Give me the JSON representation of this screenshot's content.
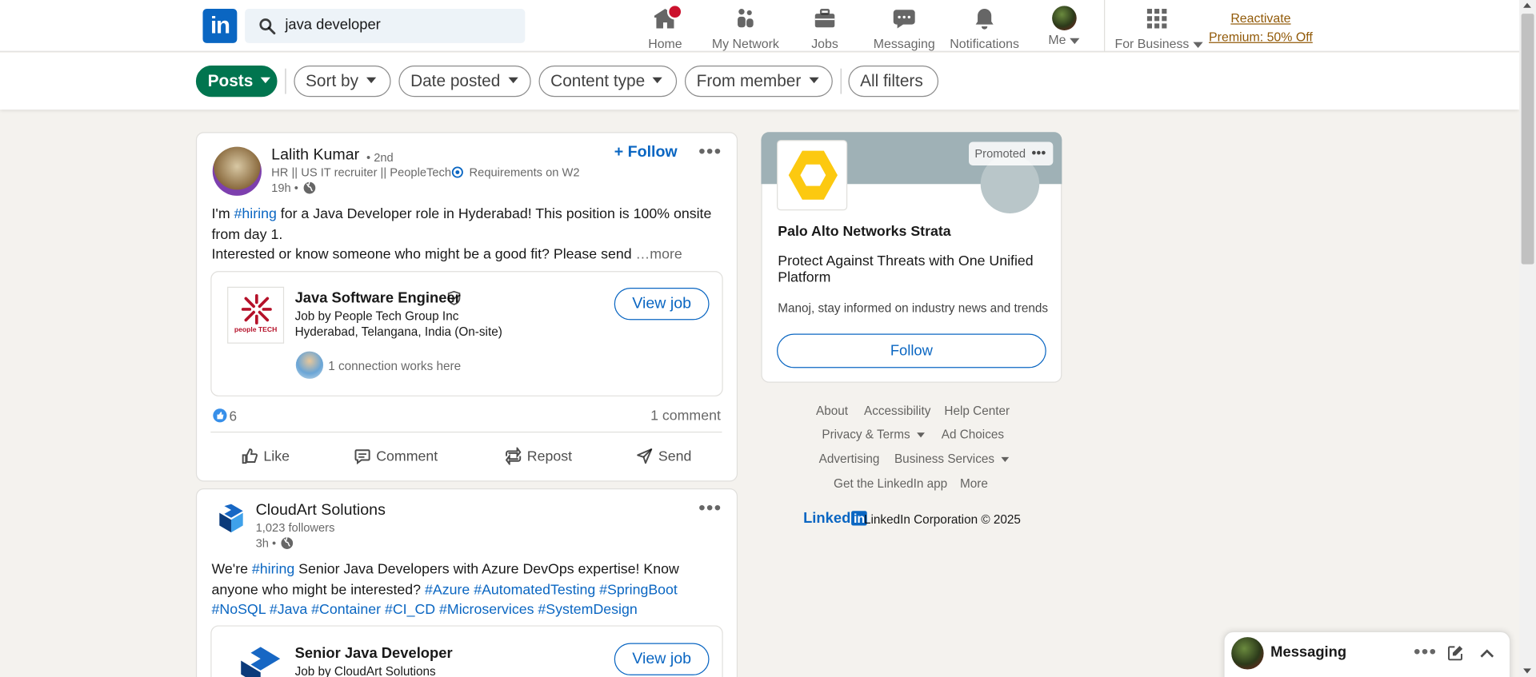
{
  "header": {
    "logo": "in",
    "search_value": "java developer",
    "nav": [
      {
        "label": "Home",
        "icon": "home-icon"
      },
      {
        "label": "My Network",
        "icon": "people-icon"
      },
      {
        "label": "Jobs",
        "icon": "briefcase-icon"
      },
      {
        "label": "Messaging",
        "icon": "chat-icon"
      },
      {
        "label": "Notifications",
        "icon": "bell-icon"
      },
      {
        "label": "Me",
        "icon": "avatar"
      },
      {
        "label": "For Business",
        "icon": "grid-icon"
      }
    ],
    "premium": "Reactivate Premium: 50% Off"
  },
  "filters": {
    "posts": "Posts",
    "sort_by": "Sort by",
    "date_posted": "Date posted",
    "content_type": "Content type",
    "from_member": "From member",
    "all_filters": "All filters"
  },
  "post1": {
    "author": "Lalith Kumar",
    "degree": "• 2nd",
    "headline": "HR || US IT recruiter || PeopleTech",
    "headline_extra": "Requirements on W2",
    "time": "19h •",
    "follow": "+ Follow",
    "text_pre": "I'm ",
    "hashtag": "#hiring",
    "text_post": " for a Java Developer role in Hyderabad! This position is 100% onsite from day 1.",
    "text_line3": "Interested or know someone who might be a good fit? Please send",
    "more": "…more",
    "job": {
      "title": "Java Software Engineer",
      "company": "Job by People Tech Group Inc",
      "location": "Hyderabad, Telangana, India (On-site)",
      "connection": "1 connection works here",
      "logo_text": "people TECH",
      "view_job": "View job"
    },
    "reactions": "6",
    "comments": "1 comment",
    "actions": {
      "like": "Like",
      "comment": "Comment",
      "repost": "Repost",
      "send": "Send"
    }
  },
  "post2": {
    "author": "CloudArt Solutions",
    "followers": "1,023 followers",
    "time": "3h •",
    "text_pre": "We're ",
    "hashtag": "#hiring",
    "text_post": " Senior Java Developers with Azure DevOps expertise! Know anyone who might be interested?",
    "tags": "#Azure #AutomatedTesting #SpringBoot #NoSQL #Java #Container #CI_CD #Microservices #SystemDesign",
    "job": {
      "title": "Senior Java Developer",
      "company": "Job by CloudArt Solutions",
      "view_job": "View job"
    }
  },
  "ad": {
    "promoted": "Promoted",
    "company": "Palo Alto Networks Strata",
    "headline": "Protect Against Threats with One Unified Platform",
    "subtext": "Manoj, stay informed on industry news and trends",
    "follow": "Follow"
  },
  "footer": {
    "links_row1": [
      "About",
      "Accessibility",
      "Help Center"
    ],
    "privacy": "Privacy & Terms",
    "ad_choices": "Ad Choices",
    "advertising": "Advertising",
    "business_services": "Business Services",
    "get_app": "Get the LinkedIn app",
    "more": "More",
    "brand": "Linked",
    "brand_in": "in",
    "copyright": "LinkedIn Corporation © 2025"
  },
  "messaging": {
    "label": "Messaging"
  },
  "colors": {
    "brand": "#0a66c2",
    "posts_pill": "#01754f",
    "premium": "#915907",
    "badge": "#cb112d"
  }
}
